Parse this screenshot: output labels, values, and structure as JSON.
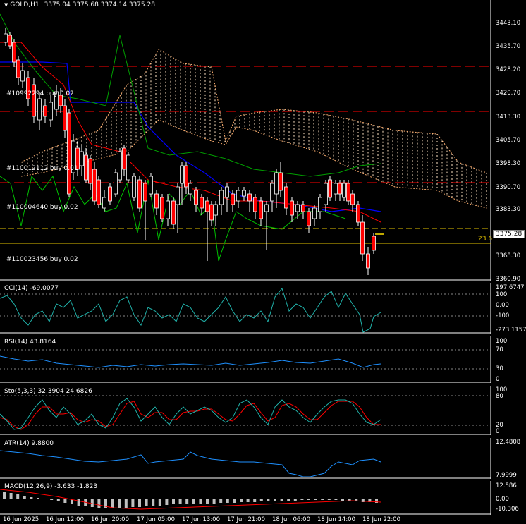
{
  "header": {
    "symbol": "GOLD,H1",
    "ohlc": "3375.04 3375.68 3374.14 3375.28",
    "arrow_icon": "triangle-down-icon"
  },
  "price_axis": {
    "labels": [
      "3443.10",
      "3435.70",
      "3428.20",
      "3420.70",
      "3413.30",
      "3405.70",
      "3398.30",
      "3390.70",
      "3383.30",
      "3368.30",
      "3360.90"
    ],
    "current_price": "3375.28",
    "fib_label": "23.6"
  },
  "orders": [
    {
      "label": "#10992294 buy 0.02"
    },
    {
      "label": "#110012112 buy 0.01"
    },
    {
      "label": "#110004640 buy 0.02"
    },
    {
      "label": "#110023456 buy 0.02"
    }
  ],
  "indicators": {
    "cci": {
      "title": "CCI(14) -69.0077",
      "levels": [
        "197.6747",
        "100",
        "0.00",
        "-100",
        "-273.1157"
      ]
    },
    "rsi": {
      "title": "RSI(14) 43.8164",
      "levels": [
        "100",
        "70",
        "30",
        "0"
      ]
    },
    "sto": {
      "title": "Sto(5,3,3) 32.3904 24.6826",
      "levels": [
        "100",
        "80",
        "20",
        "0"
      ]
    },
    "atr": {
      "title": "ATR(14) 9.8800",
      "levels": [
        "12.4808",
        "7.9999"
      ]
    },
    "macd": {
      "title": "MACD(12,26,9) -3.633 -1.823",
      "levels": [
        "12.586",
        "0.00",
        "-10.306"
      ]
    }
  },
  "time_axis": [
    "16 Jun 2025",
    "16 Jun 12:00",
    "16 Jun 20:00",
    "17 Jun 05:00",
    "17 Jun 13:00",
    "17 Jun 21:00",
    "18 Jun 06:00",
    "18 Jun 14:00",
    "18 Jun 22:00"
  ],
  "colors": {
    "background": "#000000",
    "bull_candle": "#ffffff",
    "bear_candle": "#ff0000",
    "ma_fast": "#ff0000",
    "ma_slow": "#0000ff",
    "chikou": "#00c000",
    "kumo": "#ffe4c4",
    "cci": "#20b2aa",
    "rsi": "#1e90ff",
    "sto_main": "#20b2aa",
    "sto_signal": "#ff0000",
    "atr": "#1e90ff",
    "macd_signal": "#ff0000"
  }
}
